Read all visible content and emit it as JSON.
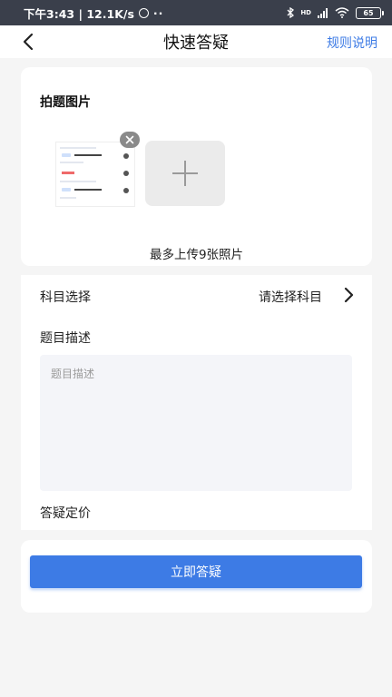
{
  "status_bar": {
    "time_speed": "下午3:43 | 12.1K/s",
    "dots": "··",
    "network": "HD",
    "battery": "65"
  },
  "header": {
    "title": "快速答疑",
    "rules_link": "规则说明"
  },
  "photos": {
    "section_title": "拍题图片",
    "upload_hint": "最多上传9张照片"
  },
  "form": {
    "subject_label": "科目选择",
    "subject_value": "请选择科目",
    "description_label": "题目描述",
    "description_placeholder": "题目描述",
    "price_label": "答疑定价"
  },
  "submit": {
    "label": "立即答疑"
  },
  "colors": {
    "accent": "#3d7be5",
    "status_bar": "#3a3f4b"
  }
}
